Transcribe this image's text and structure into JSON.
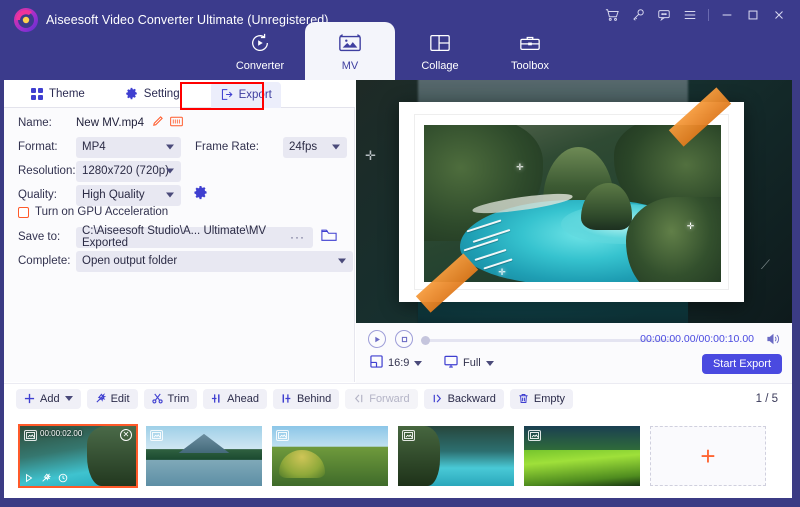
{
  "window": {
    "title": "Aiseesoft Video Converter Ultimate (Unregistered)",
    "controls": [
      {
        "name": "cart-icon",
        "label": "Cart"
      },
      {
        "name": "key-icon",
        "label": "Register"
      },
      {
        "name": "feedback-icon",
        "label": "Feedback"
      },
      {
        "name": "menu-icon",
        "label": "Menu"
      },
      {
        "name": "minimize-icon",
        "label": "Minimize"
      },
      {
        "name": "maximize-icon",
        "label": "Maximize"
      },
      {
        "name": "close-icon",
        "label": "Close"
      }
    ]
  },
  "nav": {
    "tabs": [
      {
        "label": "Converter",
        "icon": "converter-icon",
        "active": false
      },
      {
        "label": "MV",
        "icon": "mv-icon",
        "active": true
      },
      {
        "label": "Collage",
        "icon": "collage-icon",
        "active": false
      },
      {
        "label": "Toolbox",
        "icon": "toolbox-icon",
        "active": false
      }
    ]
  },
  "subtabs": [
    {
      "label": "Theme",
      "icon": "grid-icon",
      "active": false
    },
    {
      "label": "Setting",
      "icon": "gear-icon",
      "active": false
    },
    {
      "label": "Export",
      "icon": "export-icon",
      "active": true
    }
  ],
  "export_form": {
    "name_label": "Name:",
    "name_value": "New MV.mp4",
    "format_label": "Format:",
    "format_value": "MP4",
    "framerate_label": "Frame Rate:",
    "framerate_value": "24fps",
    "resolution_label": "Resolution:",
    "resolution_value": "1280x720 (720p)",
    "quality_label": "Quality:",
    "quality_value": "High Quality",
    "gpu_label": "Turn on GPU Acceleration",
    "gpu_checked": false,
    "saveto_label": "Save to:",
    "saveto_value": "C:\\Aiseesoft Studio\\A... Ultimate\\MV Exported",
    "saveto_more": "···",
    "complete_label": "Complete:",
    "complete_value": "Open output folder",
    "start_export": "Start Export"
  },
  "player": {
    "current_time": "00:00:00.00",
    "total_time": "00:00:10.00",
    "timecode": "00:00:00.00/00:00:10.00",
    "aspect_ratio": "16:9",
    "screen_mode": "Full",
    "start_export": "Start Export"
  },
  "toolbar": {
    "buttons": [
      {
        "label": "Add",
        "icon": "plus-icon",
        "disabled": false,
        "has_caret": true
      },
      {
        "label": "Edit",
        "icon": "wand-icon",
        "disabled": false,
        "has_caret": false
      },
      {
        "label": "Trim",
        "icon": "scissors-icon",
        "disabled": false,
        "has_caret": false
      },
      {
        "label": "Ahead",
        "icon": "insert-ahead-icon",
        "disabled": false,
        "has_caret": false
      },
      {
        "label": "Behind",
        "icon": "insert-behind-icon",
        "disabled": false,
        "has_caret": false
      },
      {
        "label": "Forward",
        "icon": "move-forward-icon",
        "disabled": true,
        "has_caret": false
      },
      {
        "label": "Backward",
        "icon": "move-backward-icon",
        "disabled": false,
        "has_caret": false
      },
      {
        "label": "Empty",
        "icon": "trash-icon",
        "disabled": false,
        "has_caret": false
      }
    ],
    "page_count": "1 / 5"
  },
  "clips": [
    {
      "name": "clip-lagoon-bay",
      "art": "a-lagoon",
      "selected": true,
      "duration": "00:00:02.00"
    },
    {
      "name": "clip-volcano-lake",
      "art": "a-volcano",
      "selected": false,
      "duration": ""
    },
    {
      "name": "clip-chocolate-hills",
      "art": "a-hills",
      "selected": false,
      "duration": ""
    },
    {
      "name": "clip-kayak-lagoon",
      "art": "a-kayak",
      "selected": false,
      "duration": ""
    },
    {
      "name": "clip-rice-terraces",
      "art": "a-rice",
      "selected": false,
      "duration": ""
    }
  ],
  "add_clip": {
    "label": "+"
  },
  "colors": {
    "titlebar": "#3b3b8c",
    "accent": "#4a4ae0",
    "highlight_red": "#ff0000",
    "orange": "#ff5a2a",
    "tape": "#e07b1e",
    "panel_bg": "#fbfbfd"
  }
}
